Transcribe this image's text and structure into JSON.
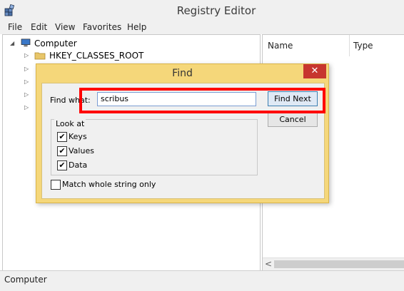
{
  "window": {
    "title": "Registry Editor"
  },
  "menu": [
    "File",
    "Edit",
    "View",
    "Favorites",
    "Help"
  ],
  "tree": {
    "root": "Computer",
    "items": [
      "HKEY_CLASSES_ROOT"
    ]
  },
  "list": {
    "columns": [
      "Name",
      "Type"
    ]
  },
  "status": "Computer",
  "find_dialog": {
    "title": "Find",
    "close_symbol": "✕",
    "find_what_label": "Find what:",
    "find_what_value": "scribus",
    "find_next_label": "Find Next",
    "cancel_label": "Cancel",
    "look_at_label": "Look at",
    "options": [
      {
        "label": "Keys",
        "checked": true
      },
      {
        "label": "Values",
        "checked": true
      },
      {
        "label": "Data",
        "checked": true
      }
    ],
    "match_whole_label": "Match whole string only",
    "match_whole_checked": false
  },
  "colors": {
    "dialog_frame": "#f5d77a",
    "close_button": "#c7352f",
    "highlight": "#ff0000"
  }
}
